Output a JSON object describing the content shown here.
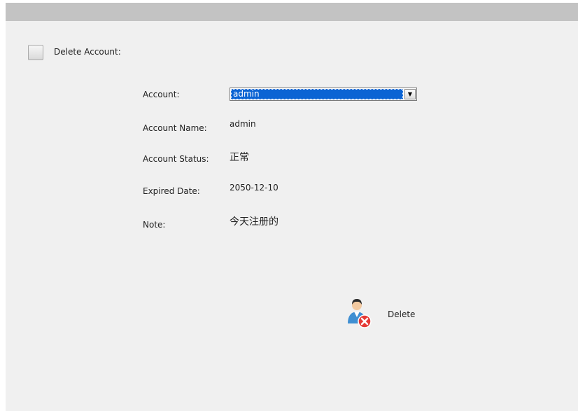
{
  "section": {
    "title": "Delete Account:"
  },
  "form": {
    "account_label": "Account:",
    "account_value": "admin",
    "account_name_label": "Account Name:",
    "account_name_value": "admin",
    "account_status_label": "Account Status:",
    "account_status_value": "正常",
    "expired_date_label": "Expired Date:",
    "expired_date_value": "2050-12-10",
    "note_label": "Note:",
    "note_value": "今天注册的"
  },
  "actions": {
    "delete_label": "Delete",
    "delete_icon": "user-delete-icon"
  },
  "colors": {
    "selection": "#0b64d4",
    "panel_bg": "#f0f0f0",
    "titlebar": "#c3c3c3",
    "delete_badge": "#e53935"
  }
}
